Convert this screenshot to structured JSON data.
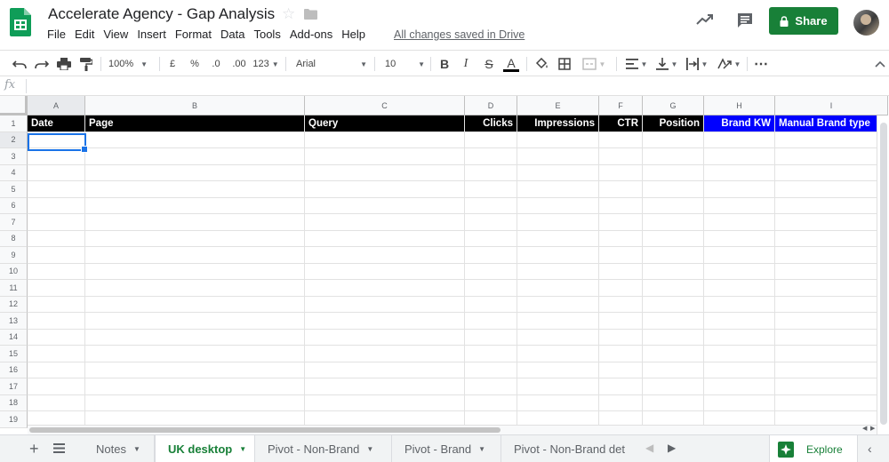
{
  "header": {
    "title": "Accelerate Agency - Gap Analysis",
    "saved_status": "All changes saved in Drive",
    "share_label": "Share",
    "menu": [
      "File",
      "Edit",
      "View",
      "Insert",
      "Format",
      "Data",
      "Tools",
      "Add-ons",
      "Help"
    ]
  },
  "toolbar": {
    "zoom": "100%",
    "currency": "£",
    "percent": "%",
    "decrease_decimal": ".0",
    "increase_decimal": ".00",
    "more_formats": "123",
    "font": "Arial",
    "font_size": "10",
    "bold": "B",
    "italic": "I",
    "strikethrough": "S",
    "text_color": "A"
  },
  "formula_bar": {
    "fx": "fx",
    "value": ""
  },
  "grid": {
    "column_letters": [
      "A",
      "B",
      "C",
      "D",
      "E",
      "F",
      "G",
      "H",
      "I"
    ],
    "row_numbers": [
      "1",
      "2",
      "3",
      "4",
      "5",
      "6",
      "7",
      "8",
      "9",
      "10",
      "11",
      "12",
      "13",
      "14",
      "15",
      "16",
      "17",
      "18",
      "19"
    ],
    "header_row": [
      "Date",
      "Page",
      "Query",
      "Clicks",
      "Impressions",
      "CTR",
      "Position",
      "Brand KW",
      "Manual Brand type"
    ],
    "selected_cell": "A2",
    "colors": {
      "header_bg": "#000000",
      "brand_header_bg": "#0000ff",
      "header_text": "#ffffff",
      "selection": "#1a73e8"
    }
  },
  "sheets": {
    "tabs": [
      "Notes",
      "UK desktop",
      "Pivot - Non-Brand",
      "Pivot - Brand",
      "Pivot - Non-Brand det"
    ],
    "active": "UK desktop",
    "explore_label": "Explore"
  },
  "icons": {
    "logo": "sheets-logo-icon",
    "star": "star-icon",
    "folder": "folder-icon",
    "trend": "activity-trend-icon",
    "comment": "comment-icon",
    "lock": "lock-icon"
  },
  "colors": {
    "brand_green": "#188038",
    "share_bg": "#188038"
  }
}
